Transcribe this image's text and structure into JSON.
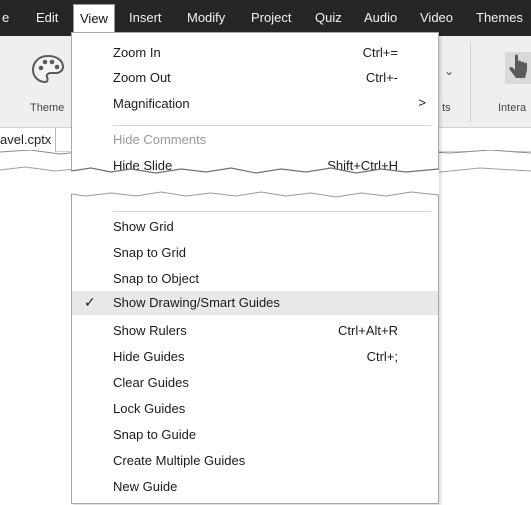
{
  "menubar": {
    "items": [
      {
        "label": "e"
      },
      {
        "label": "Edit"
      },
      {
        "label": "View"
      },
      {
        "label": "Insert"
      },
      {
        "label": "Modify"
      },
      {
        "label": "Project"
      },
      {
        "label": "Quiz"
      },
      {
        "label": "Audio"
      },
      {
        "label": "Video"
      },
      {
        "label": "Themes"
      }
    ]
  },
  "ribbon": {
    "themes_label": "Theme",
    "assets_label": "ts",
    "interactions_label": "Intera"
  },
  "file_tab": {
    "label": "avel.cptx"
  },
  "view_menu": {
    "items": [
      {
        "label": "Zoom In",
        "shortcut": "Ctrl+="
      },
      {
        "label": "Zoom Out",
        "shortcut": "Ctrl+-"
      },
      {
        "label": "Magnification",
        "arrow": ">"
      },
      {
        "label": "Hide Comments"
      },
      {
        "label": "Hide Slide",
        "shortcut": "Shift+Ctrl+H"
      },
      {
        "label": "Show Grid"
      },
      {
        "label": "Snap to Grid"
      },
      {
        "label": "Snap to Object"
      },
      {
        "label": "Show Drawing/Smart Guides",
        "check": "✓"
      },
      {
        "label": "Show Rulers",
        "shortcut": "Ctrl+Alt+R"
      },
      {
        "label": "Hide Guides",
        "shortcut": "Ctrl+;"
      },
      {
        "label": "Clear Guides"
      },
      {
        "label": "Lock Guides"
      },
      {
        "label": "Snap to Guide"
      },
      {
        "label": "Create Multiple Guides"
      },
      {
        "label": "New Guide"
      }
    ]
  },
  "colors": {
    "menubar_bg": "#262626",
    "ribbon_bg": "#efefef",
    "checked_row_bg": "#e8e8e8",
    "disabled_text": "#9a9a9a"
  }
}
